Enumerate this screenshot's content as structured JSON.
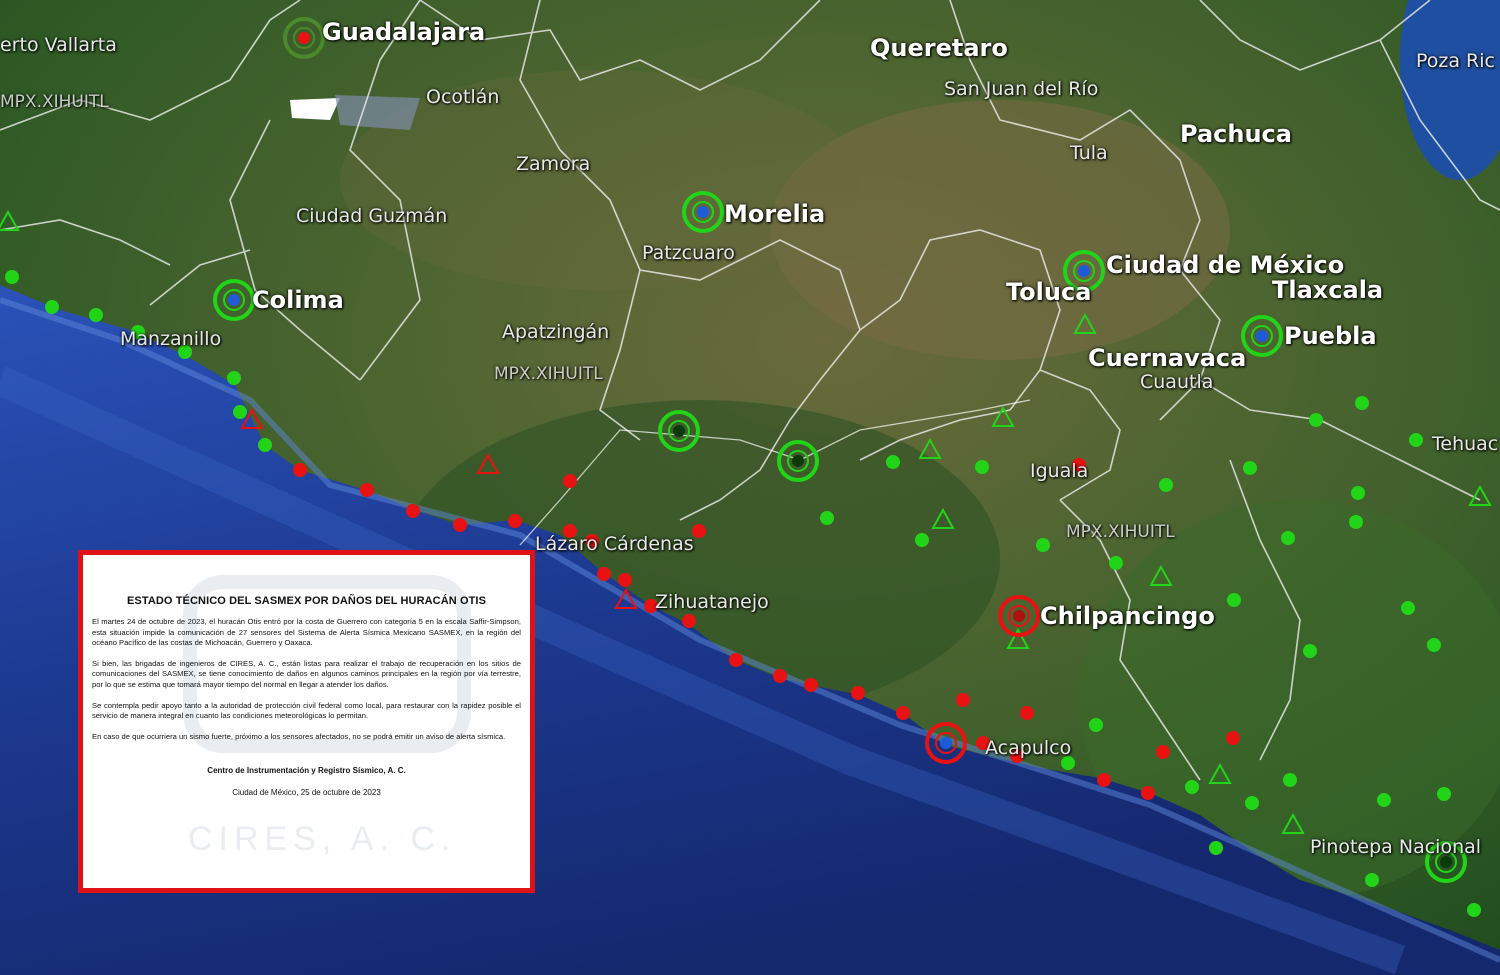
{
  "cities_major": [
    {
      "id": "guadalajara",
      "name": "Guadalajara"
    },
    {
      "id": "morelia",
      "name": "Morelia"
    },
    {
      "id": "colima",
      "name": "Colima"
    },
    {
      "id": "queretaro",
      "name": "Queretaro"
    },
    {
      "id": "pachuca",
      "name": "Pachuca"
    },
    {
      "id": "cdmx",
      "name": "Ciudad de México"
    },
    {
      "id": "toluca",
      "name": "Toluca"
    },
    {
      "id": "tlaxcala",
      "name": "Tlaxcala"
    },
    {
      "id": "puebla",
      "name": "Puebla"
    },
    {
      "id": "cuernavaca",
      "name": "Cuernavaca"
    },
    {
      "id": "chilpancingo",
      "name": "Chilpancingo"
    }
  ],
  "cities_minor": [
    {
      "id": "vallarta",
      "name": "erto Vallarta"
    },
    {
      "id": "ocotlan",
      "name": "Ocotlán"
    },
    {
      "id": "zamora",
      "name": "Zamora"
    },
    {
      "id": "guzman",
      "name": "Ciudad Guzmán"
    },
    {
      "id": "patzcuaro",
      "name": "Patzcuaro"
    },
    {
      "id": "manzanillo",
      "name": "Manzanillo"
    },
    {
      "id": "apatzingan",
      "name": "Apatzingán"
    },
    {
      "id": "sanjuan",
      "name": "San Juan del Río"
    },
    {
      "id": "tula",
      "name": "Tula"
    },
    {
      "id": "pozarica",
      "name": "Poza Ric"
    },
    {
      "id": "cuautla",
      "name": "Cuautla"
    },
    {
      "id": "iguala",
      "name": "Iguala"
    },
    {
      "id": "tehuacan",
      "name": "Tehuac"
    },
    {
      "id": "lazaro",
      "name": "Lázaro Cárdenas"
    },
    {
      "id": "zihuatanejo",
      "name": "Zihuatanejo"
    },
    {
      "id": "acapulco",
      "name": "Acapulco"
    },
    {
      "id": "pinotepa",
      "name": "Pinotepa Nacional"
    }
  ],
  "network_labels": [
    "MPX.XIHUITL",
    "MPX.XIHUITL",
    "MPX.XIHUITL"
  ],
  "legend_colors": {
    "sensor_ok": "#22d418",
    "sensor_down": "#e81212",
    "city_marker": "#1f5bd8",
    "notice_border": "#e01218"
  },
  "notice": {
    "title": "ESTADO TÉCNICO DEL SASMEX POR DAÑOS DEL HURACÁN OTIS",
    "paragraphs": [
      "El martes 24 de octubre de 2023, el huracán Otis entró por la costa de Guerrero con categoría 5 en la escala Saffir-Simpson, esta situación impide la comunicación de 27 sensores del Sistema de Alerta Sísmica Mexicano SASMEX, en la región del océano Pacífico de las costas de Michoacán, Guerrero y Oaxaca.",
      "Si bien, las brigadas de ingenieros de CIRES, A. C., están listas para realizar el trabajo de recuperación en los sitios de comunicaciones del SASMEX, se tiene conocimiento de daños en algunos caminos principales en la región por vía terrestre, por lo que se estima que tomará mayor tiempo del normal en llegar a atender los daños.",
      "Se contempla pedir apoyo tanto a la autoridad de protección civil federal como local, para restaurar con la rapidez posible el servicio de manera integral en cuanto las condiciones meteorológicas lo permitan.",
      "En caso de que ocurriera un sismo fuerte, próximo a los sensores afectados, no se podrá emitir un aviso de alerta sísmica."
    ],
    "signature": "Centro de Instrumentación y Registro Sísmico, A. C.",
    "date": "Ciudad de México, 25 de octubre de 2023",
    "watermark": "CIRES, A. C."
  }
}
